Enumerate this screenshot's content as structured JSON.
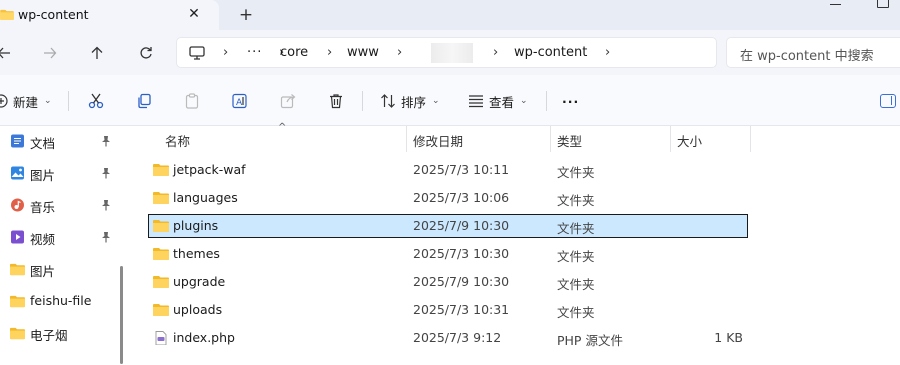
{
  "window": {
    "tab_title": "wp-content",
    "new_tab_symbol": "+",
    "close_symbol": "✕"
  },
  "address_bar": {
    "breadcrumbs": [
      "core",
      "www",
      "wp-content"
    ],
    "overflow": "···",
    "search_placeholder": "在 wp-content 中搜索"
  },
  "commands": {
    "new": "新建",
    "sort": "排序",
    "view": "查看",
    "more": "···"
  },
  "sidebar": {
    "items": [
      {
        "label": "文档",
        "icon": "documents-icon",
        "pinned": true
      },
      {
        "label": "图片",
        "icon": "pictures-icon",
        "pinned": true
      },
      {
        "label": "音乐",
        "icon": "music-icon",
        "pinned": true
      },
      {
        "label": "视频",
        "icon": "videos-icon",
        "pinned": true
      },
      {
        "label": "图片",
        "icon": "folder-icon",
        "pinned": false
      },
      {
        "label": "feishu-file",
        "icon": "folder-icon",
        "pinned": false
      },
      {
        "label": "电子烟",
        "icon": "folder-icon",
        "pinned": false
      }
    ]
  },
  "file_list": {
    "columns": {
      "name": "名称",
      "modified": "修改日期",
      "type": "类型",
      "size": "大小"
    },
    "rows": [
      {
        "name": "jetpack-waf",
        "modified": "2025/7/3 10:11",
        "type": "文件夹",
        "size": "",
        "icon": "folder-icon",
        "selected": false
      },
      {
        "name": "languages",
        "modified": "2025/7/3 10:06",
        "type": "文件夹",
        "size": "",
        "icon": "folder-icon",
        "selected": false
      },
      {
        "name": "plugins",
        "modified": "2025/7/9 10:30",
        "type": "文件夹",
        "size": "",
        "icon": "folder-icon",
        "selected": true
      },
      {
        "name": "themes",
        "modified": "2025/7/3 10:30",
        "type": "文件夹",
        "size": "",
        "icon": "folder-icon",
        "selected": false
      },
      {
        "name": "upgrade",
        "modified": "2025/7/9 10:30",
        "type": "文件夹",
        "size": "",
        "icon": "folder-icon",
        "selected": false
      },
      {
        "name": "uploads",
        "modified": "2025/7/3 10:31",
        "type": "文件夹",
        "size": "",
        "icon": "folder-icon",
        "selected": false
      },
      {
        "name": "index.php",
        "modified": "2025/7/3 9:12",
        "type": "PHP 源文件",
        "size": "1 KB",
        "icon": "php-file-icon",
        "selected": false
      }
    ]
  },
  "colors": {
    "selection_bg": "#cce8ff",
    "folder": "#f8c33a",
    "accent": "#3a6fd8"
  }
}
